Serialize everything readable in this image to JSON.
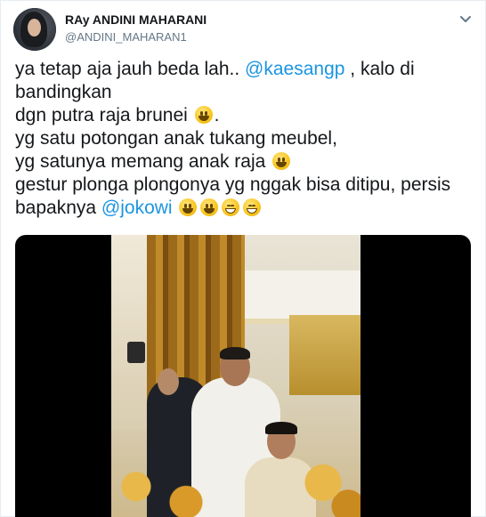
{
  "tweet": {
    "author": {
      "display_name": "RAy ANDINI MAHARANI",
      "handle": "@ANDINI_MAHARAN1"
    },
    "text": {
      "line1_pre": "ya tetap aja jauh beda lah.. ",
      "line1_mention": "@kaesangp",
      "line1_post": " , kalo di",
      "line2": "bandingkan",
      "line3": "dgn  putra raja brunei ",
      "line3_post": ".",
      "line4": "yg satu potongan anak tukang meubel,",
      "line5": "yg satunya memang anak raja ",
      "line6": "gestur plonga plongonya yg nggak bisa ditipu,  persis",
      "line7_pre": "bapaknya ",
      "line7_mention": "@jokowi"
    },
    "icons": {
      "menu_caret": "chevron-down-icon",
      "emoji_smile": "grinning-face-icon",
      "emoji_grin": "grinning-face-with-smiling-eyes-icon"
    },
    "colors": {
      "mention": "#1b95e0",
      "text": "#14171a",
      "handle": "#657786"
    }
  }
}
